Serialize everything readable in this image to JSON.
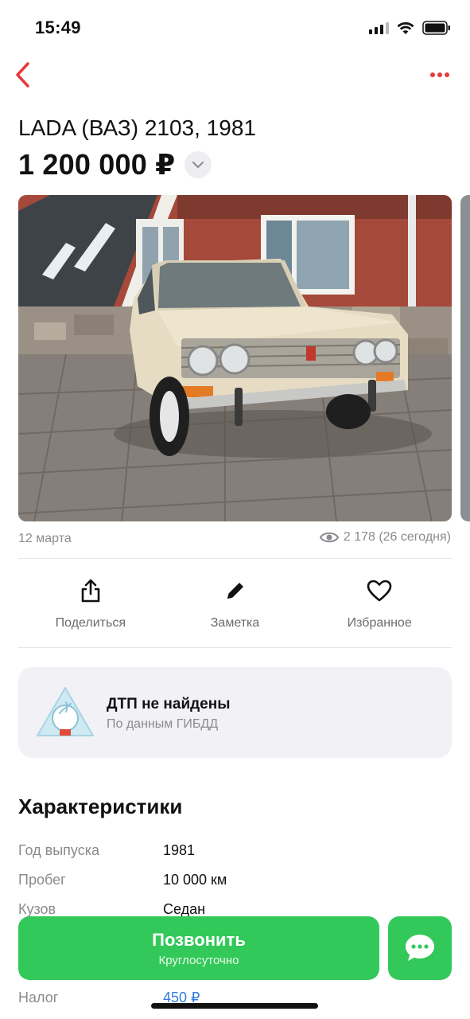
{
  "status_bar": {
    "time": "15:49"
  },
  "listing": {
    "title": "LADA (ВАЗ) 2103, 1981",
    "price": "1 200 000 ₽",
    "date": "12 марта",
    "views": "2 178 (26 сегодня)"
  },
  "actions": [
    {
      "label": "Поделиться",
      "icon": "share-icon"
    },
    {
      "label": "Заметка",
      "icon": "pencil-icon"
    },
    {
      "label": "Избранное",
      "icon": "heart-icon"
    }
  ],
  "accident_card": {
    "title": "ДТП не найдены",
    "subtitle": "По данным ГИБДД"
  },
  "characteristics": {
    "title": "Характеристики",
    "rows": [
      {
        "label": "Год выпуска",
        "value": "1981"
      },
      {
        "label": "Пробег",
        "value": "10 000 км"
      },
      {
        "label": "Кузов",
        "value": "Седан"
      },
      {
        "label": "Налог",
        "value": "450 ₽"
      }
    ]
  },
  "bottom_bar": {
    "call_label": "Позвонить",
    "call_sub": "Круглосуточно"
  },
  "colors": {
    "accent_red": "#e63a3a",
    "call_green": "#33c85a",
    "link_blue": "#2f7de1",
    "muted_text": "#8a8a8f"
  }
}
